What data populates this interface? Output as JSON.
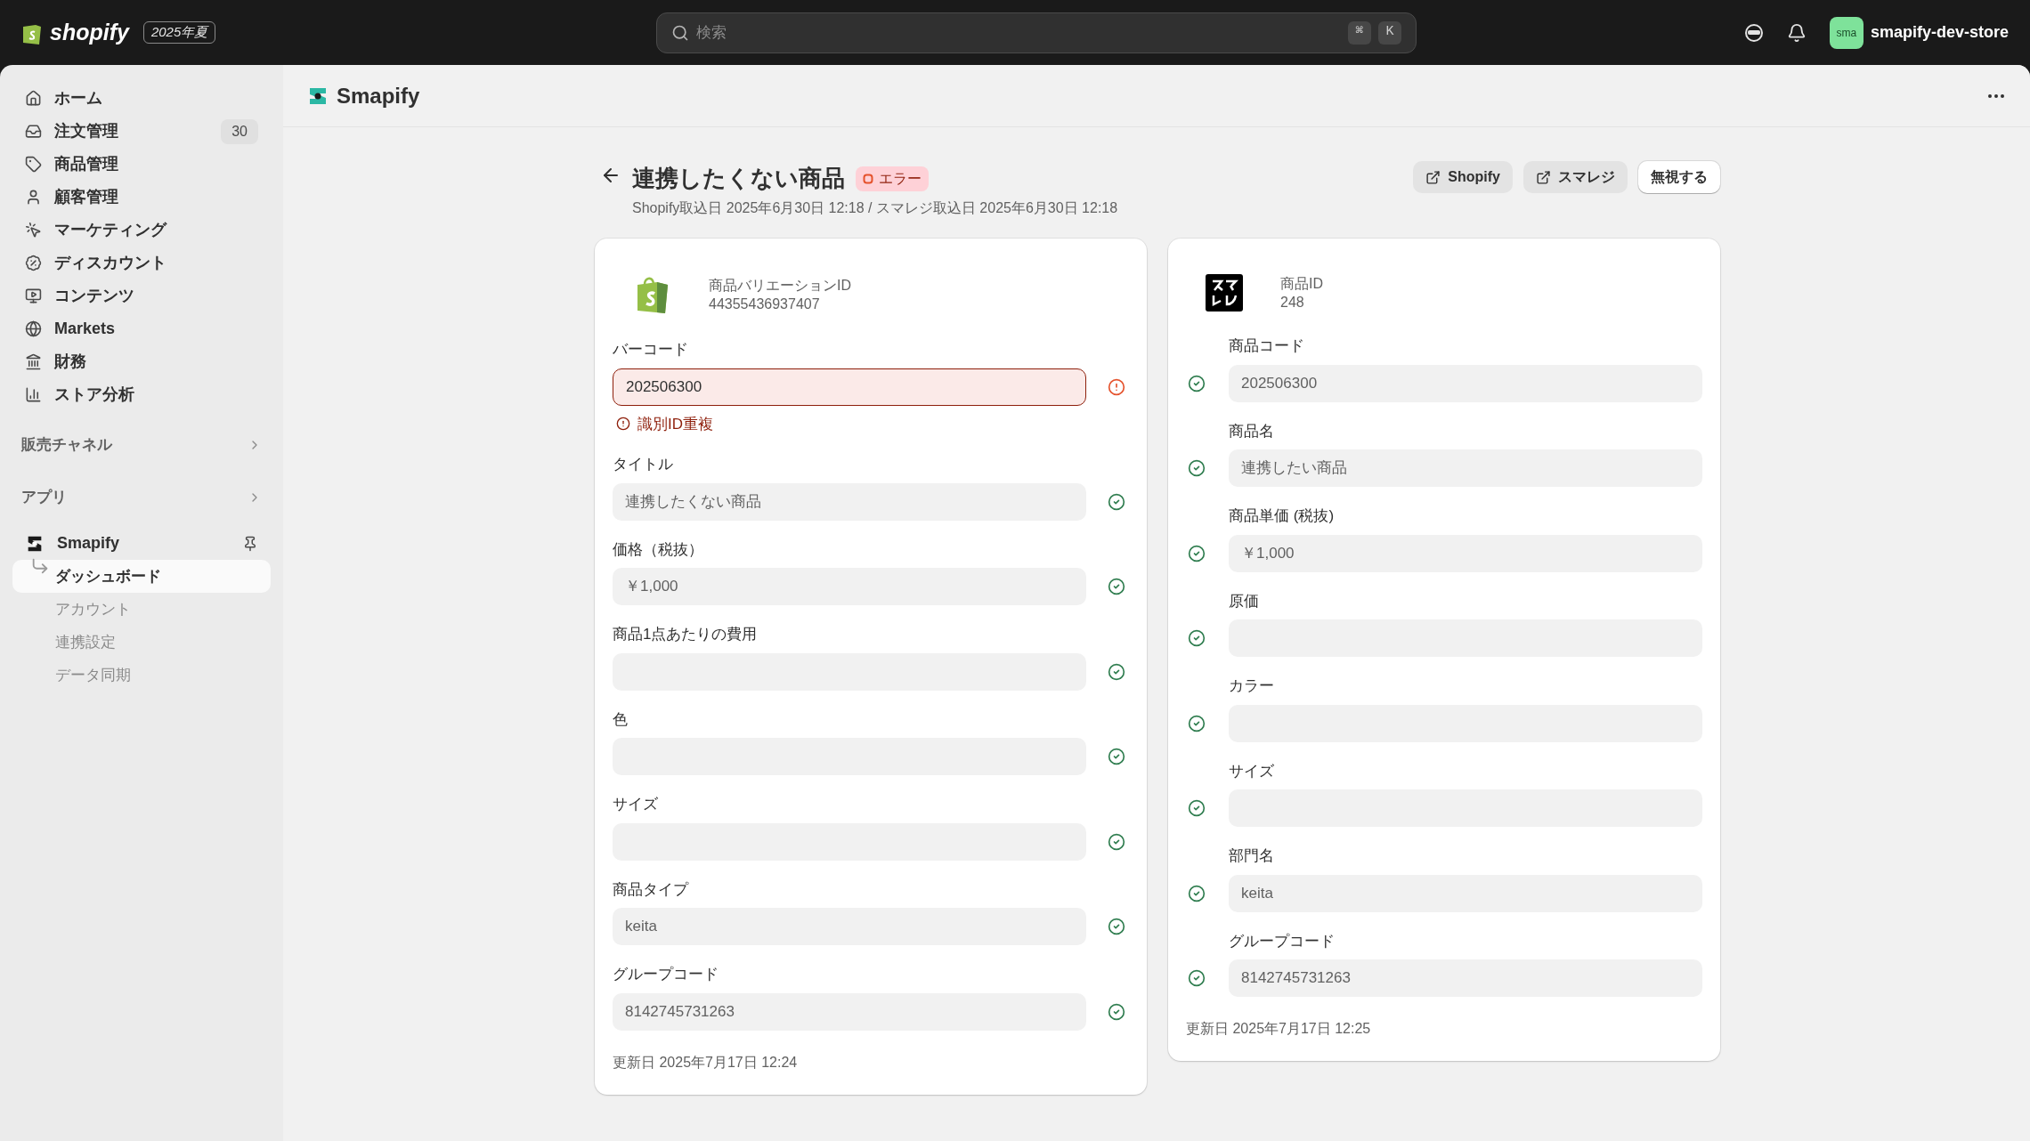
{
  "topbar": {
    "brand": "shopify",
    "edition": "2025年夏",
    "search": {
      "placeholder": "検索",
      "keys": [
        "⌘",
        "K"
      ]
    },
    "avatar": "sma",
    "store": "smapify-dev-store"
  },
  "sidebar": {
    "items": [
      {
        "label": "ホーム"
      },
      {
        "label": "注文管理",
        "count": "30"
      },
      {
        "label": "商品管理"
      },
      {
        "label": "顧客管理"
      },
      {
        "label": "マーケティング"
      },
      {
        "label": "ディスカウント"
      },
      {
        "label": "コンテンツ"
      },
      {
        "label": "Markets"
      },
      {
        "label": "財務"
      },
      {
        "label": "ストア分析"
      }
    ],
    "sections": [
      "販売チャネル",
      "アプリ"
    ],
    "app": {
      "name": "Smapify",
      "subitems": [
        {
          "label": "ダッシュボード",
          "selected": true
        },
        {
          "label": "アカウント",
          "selected": false
        },
        {
          "label": "連携設定",
          "selected": false
        },
        {
          "label": "データ同期",
          "selected": false
        }
      ]
    }
  },
  "app_header": {
    "title": "Smapify"
  },
  "page": {
    "title": "連携したくない商品",
    "status": "エラー",
    "subtitle": "Shopify取込日 2025年6月30日 12:18 / スマレジ取込日 2025年6月30日 12:18",
    "actions": [
      {
        "label": "Shopify",
        "kind": "external"
      },
      {
        "label": "スマレジ",
        "kind": "external"
      },
      {
        "label": "無視する",
        "kind": "plain"
      }
    ]
  },
  "cards": [
    {
      "kind": "shopify",
      "id_label": "商品バリエーションID",
      "id_value": "44355436937407",
      "fields": [
        {
          "label": "バーコード",
          "value": "202506300",
          "valid": false,
          "error": "識別ID重複"
        },
        {
          "label": "タイトル",
          "value": "連携したくない商品",
          "valid": true
        },
        {
          "label": "価格（税抜）",
          "value": "￥1,000",
          "valid": true
        },
        {
          "label": "商品1点あたりの費用",
          "valid": true
        },
        {
          "label": "色",
          "valid": true
        },
        {
          "label": "サイズ",
          "valid": true
        },
        {
          "label": "商品タイプ",
          "value": "keita",
          "valid": true
        },
        {
          "label": "グループコード",
          "value": "8142745731263",
          "valid": true
        }
      ],
      "updated": "更新日 2025年7月17日 12:24"
    },
    {
      "kind": "smaregi",
      "id_label": "商品ID",
      "id_value": "248",
      "fields": [
        {
          "label": "商品コード",
          "value": "202506300",
          "valid": true
        },
        {
          "label": "商品名",
          "value": "連携したい商品",
          "valid": true
        },
        {
          "label": "商品単価 (税抜)",
          "value": "￥1,000",
          "valid": true
        },
        {
          "label": "原価",
          "valid": true
        },
        {
          "label": "カラー",
          "valid": true
        },
        {
          "label": "サイズ",
          "valid": true
        },
        {
          "label": "部門名",
          "value": "keita",
          "valid": true
        },
        {
          "label": "グループコード",
          "value": "8142745731263",
          "valid": true
        }
      ],
      "updated": "更新日 2025年7月17日 12:25"
    }
  ]
}
